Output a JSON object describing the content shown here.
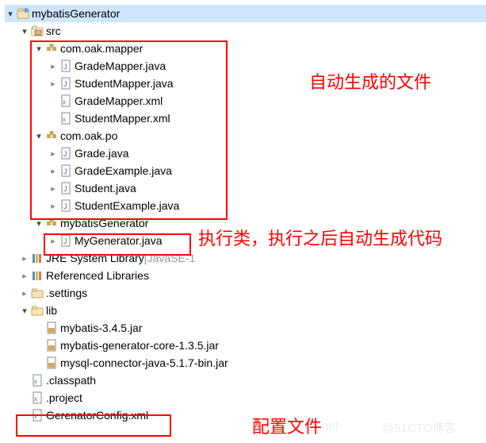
{
  "annotations": {
    "auto_generated": "自动生成的文件",
    "executor": "执行类，执行之后自动生成代码",
    "config_file": "配置文件"
  },
  "watermarks": {
    "w1": "csdn.net",
    "w2": "@51CTO博客"
  },
  "tree": {
    "root": {
      "label": "mybatisGenerator"
    },
    "src": {
      "label": "src"
    },
    "mapper_pkg": {
      "label": "com.oak.mapper"
    },
    "mapper_files": {
      "f0": "GradeMapper.java",
      "f1": "StudentMapper.java",
      "f2": "GradeMapper.xml",
      "f3": "StudentMapper.xml"
    },
    "po_pkg": {
      "label": "com.oak.po"
    },
    "po_files": {
      "f0": "Grade.java",
      "f1": "GradeExample.java",
      "f2": "Student.java",
      "f3": "StudentExample.java"
    },
    "gen_pkg": {
      "label": "mybatisGenerator"
    },
    "gen_file": "MyGenerator.java",
    "jre": {
      "label": "JRE System Library",
      "qual": " [JavaSE-1"
    },
    "reflib": "Referenced Libraries",
    "settings": ".settings",
    "lib": {
      "label": "lib"
    },
    "lib_files": {
      "f0": "mybatis-3.4.5.jar",
      "f1": "mybatis-generator-core-1.3.5.jar",
      "f2": "mysql-connector-java-5.1.7-bin.jar"
    },
    "classpath": ".classpath",
    "project": ".project",
    "gencfg": "GerenatorConfig.xml"
  }
}
